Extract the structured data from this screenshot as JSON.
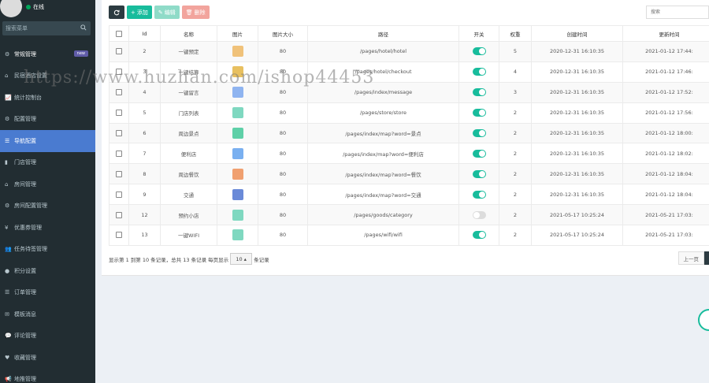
{
  "sidebar": {
    "status": "在线",
    "search_placeholder": "搜索菜单",
    "badge_new": "new",
    "items": [
      {
        "label": "常规管理",
        "icon": "cogs-icon"
      },
      {
        "label": "民宿酒店设置",
        "icon": "hotel-icon"
      },
      {
        "label": "统计控制台",
        "icon": "chart-icon"
      },
      {
        "label": "配置管理",
        "icon": "gear-icon"
      },
      {
        "label": "导航配置",
        "icon": "navigation-icon"
      },
      {
        "label": "门店管理",
        "icon": "store-icon"
      },
      {
        "label": "房间管理",
        "icon": "home-icon"
      },
      {
        "label": "房间配置管理",
        "icon": "settings-icon"
      },
      {
        "label": "优惠券管理",
        "icon": "yen-icon"
      },
      {
        "label": "任务待签管理",
        "icon": "users-icon"
      },
      {
        "label": "积分设置",
        "icon": "coin-icon"
      },
      {
        "label": "订单管理",
        "icon": "list-icon"
      },
      {
        "label": "模板消息",
        "icon": "envelope-icon"
      },
      {
        "label": "评论管理",
        "icon": "comments-icon"
      },
      {
        "label": "收藏管理",
        "icon": "heart-icon"
      },
      {
        "label": "地推管理",
        "icon": "bullhorn-icon"
      }
    ]
  },
  "toolbar": {
    "add_label": "添加",
    "edit_label": "编辑",
    "delete_label": "删除",
    "search_placeholder": "搜索"
  },
  "table": {
    "headers": [
      "Id",
      "名称",
      "图片",
      "图片大小",
      "路径",
      "开关",
      "权重",
      "创建时间",
      "更新时间"
    ],
    "rows": [
      {
        "id": "2",
        "name": "一键预定",
        "size": "80",
        "path": "/pages/hotel/hotel",
        "on": true,
        "weight": "5",
        "created": "2020-12-31 16:10:35",
        "updated": "2021-01-12 17:44:",
        "thumb": "#f0c27a"
      },
      {
        "id": "3",
        "name": "一键结算",
        "size": "80",
        "path": "/pages/hotel/checkout",
        "on": true,
        "weight": "4",
        "created": "2020-12-31 16:10:35",
        "updated": "2021-01-12 17:46:",
        "thumb": "#e8c060"
      },
      {
        "id": "4",
        "name": "一键留言",
        "size": "80",
        "path": "/pages/index/message",
        "on": true,
        "weight": "3",
        "created": "2020-12-31 16:10:35",
        "updated": "2021-01-12 17:52:",
        "thumb": "#8fb4f0"
      },
      {
        "id": "5",
        "name": "门店列表",
        "size": "80",
        "path": "/pages/store/store",
        "on": true,
        "weight": "2",
        "created": "2020-12-31 16:10:35",
        "updated": "2021-01-12 17:56:",
        "thumb": "#7fd8c0"
      },
      {
        "id": "6",
        "name": "周边景点",
        "size": "80",
        "path": "/pages/index/map?word=景点",
        "on": true,
        "weight": "2",
        "created": "2020-12-31 16:10:35",
        "updated": "2021-01-12 18:00:",
        "thumb": "#5fd0a8"
      },
      {
        "id": "7",
        "name": "便利店",
        "size": "80",
        "path": "/pages/index/map?word=便利店",
        "on": true,
        "weight": "2",
        "created": "2020-12-31 16:10:35",
        "updated": "2021-01-12 18:02:",
        "thumb": "#7ab0f0"
      },
      {
        "id": "8",
        "name": "周边餐饮",
        "size": "80",
        "path": "/pages/index/map?word=餐饮",
        "on": true,
        "weight": "2",
        "created": "2020-12-31 16:10:35",
        "updated": "2021-01-12 18:04:",
        "thumb": "#f0a070"
      },
      {
        "id": "9",
        "name": "交通",
        "size": "80",
        "path": "/pages/index/map?word=交通",
        "on": true,
        "weight": "2",
        "created": "2020-12-31 16:10:35",
        "updated": "2021-01-12 18:04:",
        "thumb": "#6a8ad8"
      },
      {
        "id": "12",
        "name": "预约小店",
        "size": "80",
        "path": "/pages/goods/category",
        "on": false,
        "weight": "2",
        "created": "2021-05-17 10:25:24",
        "updated": "2021-05-21 17:03:",
        "thumb": "#7fd8c0"
      },
      {
        "id": "13",
        "name": "一键WIFI",
        "size": "80",
        "path": "/pages/wifi/wifi",
        "on": true,
        "weight": "2",
        "created": "2021-05-17 10:25:24",
        "updated": "2021-05-21 17:03:",
        "thumb": "#7fd8c0"
      }
    ]
  },
  "pagination": {
    "info_prefix": "显示第 1 到第 10 条记录，总共 13 条记录 每页显示",
    "page_size": "10",
    "info_suffix": "条记录",
    "prev_label": "上一页"
  },
  "watermark": "https://www.huzhan.com/ishop44453",
  "colors": {
    "sidebar": "#222d32",
    "active": "#4a7bd0",
    "accent": "#18bc9c"
  }
}
